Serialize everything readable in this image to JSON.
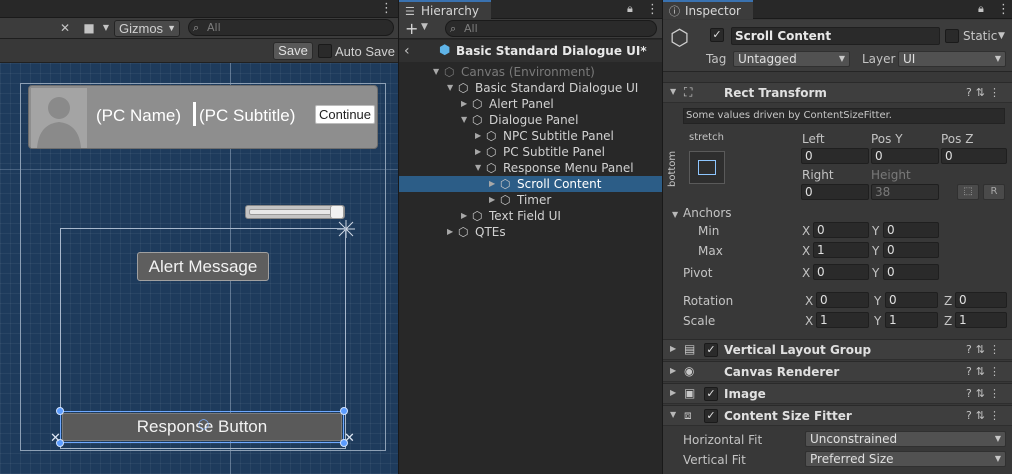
{
  "scene": {
    "gizmos_label": "Gizmos",
    "search_placeholder": "All",
    "save_label": "Save",
    "autosave_label": "Auto Save",
    "pc_name": "(PC Name)",
    "pc_subtitle": "(PC Subtitle)",
    "continue_label": "Continue",
    "alert_label": "Alert Message",
    "response_label": "Response Button"
  },
  "hierarchy": {
    "tab_label": "Hierarchy",
    "search_placeholder": "All",
    "scene_name": "Basic Standard Dialogue UI*",
    "items": [
      {
        "label": "Canvas (Environment)",
        "depth": 0,
        "fold": "open",
        "dim": true,
        "selected": false
      },
      {
        "label": "Basic Standard Dialogue UI",
        "depth": 1,
        "fold": "open",
        "dim": false,
        "selected": false
      },
      {
        "label": "Alert Panel",
        "depth": 2,
        "fold": "closed",
        "dim": false,
        "selected": false
      },
      {
        "label": "Dialogue Panel",
        "depth": 2,
        "fold": "open",
        "dim": false,
        "selected": false
      },
      {
        "label": "NPC Subtitle Panel",
        "depth": 3,
        "fold": "closed",
        "dim": false,
        "selected": false
      },
      {
        "label": "PC Subtitle Panel",
        "depth": 3,
        "fold": "closed",
        "dim": false,
        "selected": false
      },
      {
        "label": "Response Menu Panel",
        "depth": 3,
        "fold": "open",
        "dim": false,
        "selected": false
      },
      {
        "label": "Scroll Content",
        "depth": 4,
        "fold": "closed",
        "dim": false,
        "selected": true
      },
      {
        "label": "Timer",
        "depth": 4,
        "fold": "closed",
        "dim": false,
        "selected": false
      },
      {
        "label": "Text Field UI",
        "depth": 2,
        "fold": "closed",
        "dim": false,
        "selected": false
      },
      {
        "label": "QTEs",
        "depth": 1,
        "fold": "closed",
        "dim": false,
        "selected": false
      }
    ]
  },
  "inspector": {
    "tab_label": "Inspector",
    "object_name": "Scroll Content",
    "static_label": "Static",
    "tag_label": "Tag",
    "tag_value": "Untagged",
    "layer_label": "Layer",
    "layer_value": "UI",
    "rect_transform": {
      "title": "Rect Transform",
      "notice": "Some values driven by ContentSizeFitter.",
      "stretch_label": "stretch",
      "bottom_label": "bottom",
      "left_label": "Left",
      "left_value": "0",
      "posy_label": "Pos Y",
      "posy_value": "0",
      "posz_label": "Pos Z",
      "posz_value": "0",
      "right_label": "Right",
      "right_value": "0",
      "height_label": "Height",
      "height_value": "38",
      "r_label": "R",
      "anchors_label": "Anchors",
      "min_label": "Min",
      "min_x": "0",
      "min_y": "0",
      "max_label": "Max",
      "max_x": "1",
      "max_y": "0",
      "pivot_label": "Pivot",
      "pivot_x": "0",
      "pivot_y": "0",
      "rotation_label": "Rotation",
      "rot_x": "0",
      "rot_y": "0",
      "rot_z": "0",
      "scale_label": "Scale",
      "scale_x": "1",
      "scale_y": "1",
      "scale_z": "1",
      "x_axis": "X",
      "y_axis": "Y",
      "z_axis": "Z"
    },
    "components": {
      "vlg": "Vertical Layout Group",
      "canvas_renderer": "Canvas Renderer",
      "image": "Image",
      "csf": "Content Size Fitter"
    },
    "csf": {
      "hfit_label": "Horizontal Fit",
      "hfit_value": "Unconstrained",
      "vfit_label": "Vertical Fit",
      "vfit_value": "Preferred Size"
    }
  },
  "colors": {
    "selection": "#2c5d87",
    "accent": "#3a72b0",
    "scene_bg": "#1e3b5c"
  }
}
